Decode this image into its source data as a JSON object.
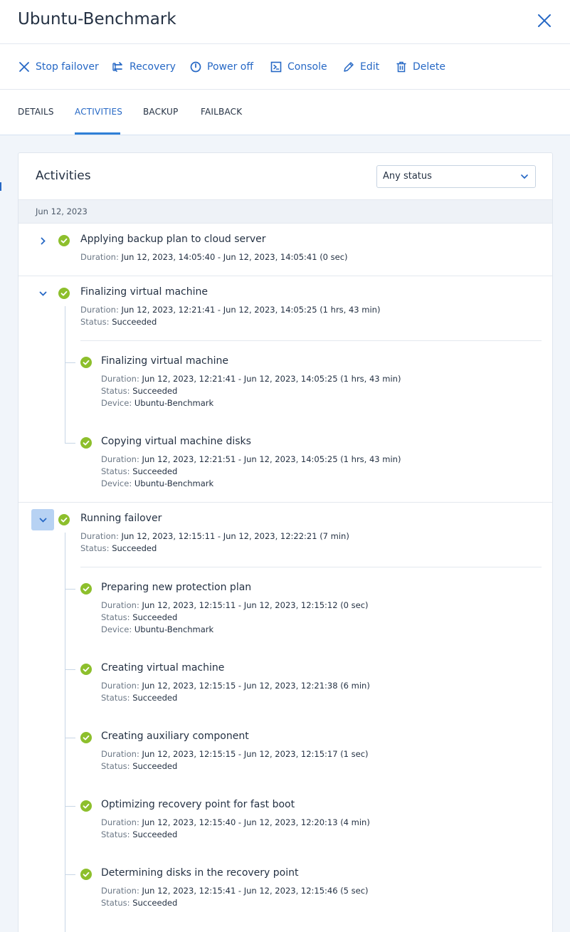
{
  "header": {
    "title": "Ubuntu-Benchmark"
  },
  "toolbar": {
    "stop_failover": "Stop failover",
    "recovery": "Recovery",
    "power_off": "Power off",
    "console": "Console",
    "edit": "Edit",
    "delete": "Delete"
  },
  "tabs": {
    "details": "DETAILS",
    "activities": "ACTIVITIES",
    "backup": "BACKUP",
    "failback": "FAILBACK",
    "active": "ACTIVITIES"
  },
  "panel": {
    "title": "Activities",
    "status_filter": "Any status",
    "date_group": "Jun 12, 2023"
  },
  "labels": {
    "duration": "Duration:",
    "status": "Status:",
    "device": "Device:"
  },
  "colors": {
    "accent": "#2668c5",
    "success": "#8dbf2c",
    "selected_expander": "#b7d2f3"
  },
  "activities": [
    {
      "title": "Applying backup plan to cloud server",
      "duration": "Jun 12, 2023, 14:05:40 - Jun 12, 2023, 14:05:41 (0 sec)",
      "expanded": false
    },
    {
      "title": "Finalizing virtual machine",
      "duration": "Jun 12, 2023, 12:21:41 - Jun 12, 2023, 14:05:25 (1 hrs, 43 min)",
      "status": "Succeeded",
      "expanded": true,
      "children": [
        {
          "title": "Finalizing virtual machine",
          "duration": "Jun 12, 2023, 12:21:41 - Jun 12, 2023, 14:05:25 (1 hrs, 43 min)",
          "status": "Succeeded",
          "device": "Ubuntu-Benchmark"
        },
        {
          "title": "Copying virtual machine disks",
          "duration": "Jun 12, 2023, 12:21:51 - Jun 12, 2023, 14:05:25 (1 hrs, 43 min)",
          "status": "Succeeded",
          "device": "Ubuntu-Benchmark"
        }
      ]
    },
    {
      "title": "Running failover",
      "duration": "Jun 12, 2023, 12:15:11 - Jun 12, 2023, 12:22:21 (7 min)",
      "status": "Succeeded",
      "expanded": true,
      "selected": true,
      "children": [
        {
          "title": "Preparing new protection plan",
          "duration": "Jun 12, 2023, 12:15:11 - Jun 12, 2023, 12:15:12 (0 sec)",
          "status": "Succeeded",
          "device": "Ubuntu-Benchmark"
        },
        {
          "title": "Creating virtual machine",
          "duration": "Jun 12, 2023, 12:15:15 - Jun 12, 2023, 12:21:38 (6 min)",
          "status": "Succeeded"
        },
        {
          "title": "Creating auxiliary component",
          "duration": "Jun 12, 2023, 12:15:15 - Jun 12, 2023, 12:15:17 (1 sec)",
          "status": "Succeeded"
        },
        {
          "title": "Optimizing recovery point for fast boot",
          "duration": "Jun 12, 2023, 12:15:40 - Jun 12, 2023, 12:20:13 (4 min)",
          "status": "Succeeded"
        },
        {
          "title": "Determining disks in the recovery point",
          "duration": "Jun 12, 2023, 12:15:41 - Jun 12, 2023, 12:15:46 (5 sec)",
          "status": "Succeeded"
        }
      ]
    }
  ]
}
